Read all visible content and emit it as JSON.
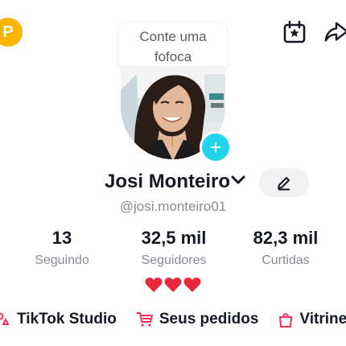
{
  "header": {
    "coin_letter": "P",
    "note_bubble": "Conte uma fofoca"
  },
  "profile": {
    "name": "Josi Monteiro",
    "handle": "@josi.monteiro01"
  },
  "stats": [
    {
      "value": "13",
      "label": "Seguindo"
    },
    {
      "value": "32,5 mil",
      "label": "Seguidores"
    },
    {
      "value": "82,3 mil",
      "label": "Curtidas"
    }
  ],
  "bio": "❤❤❤",
  "links": [
    {
      "label": "TikTok Studio",
      "icon": "studio-icon"
    },
    {
      "label": "Seus pedidos",
      "icon": "cart-icon"
    },
    {
      "label": "Vitrine",
      "icon": "shopping-bag-icon"
    }
  ],
  "colors": {
    "coin": "#f7b500",
    "add_button": "#20d5ec",
    "heart": "#e8283a",
    "secondary_text": "#8a8b91",
    "accent_pink": "#fe2c55"
  }
}
